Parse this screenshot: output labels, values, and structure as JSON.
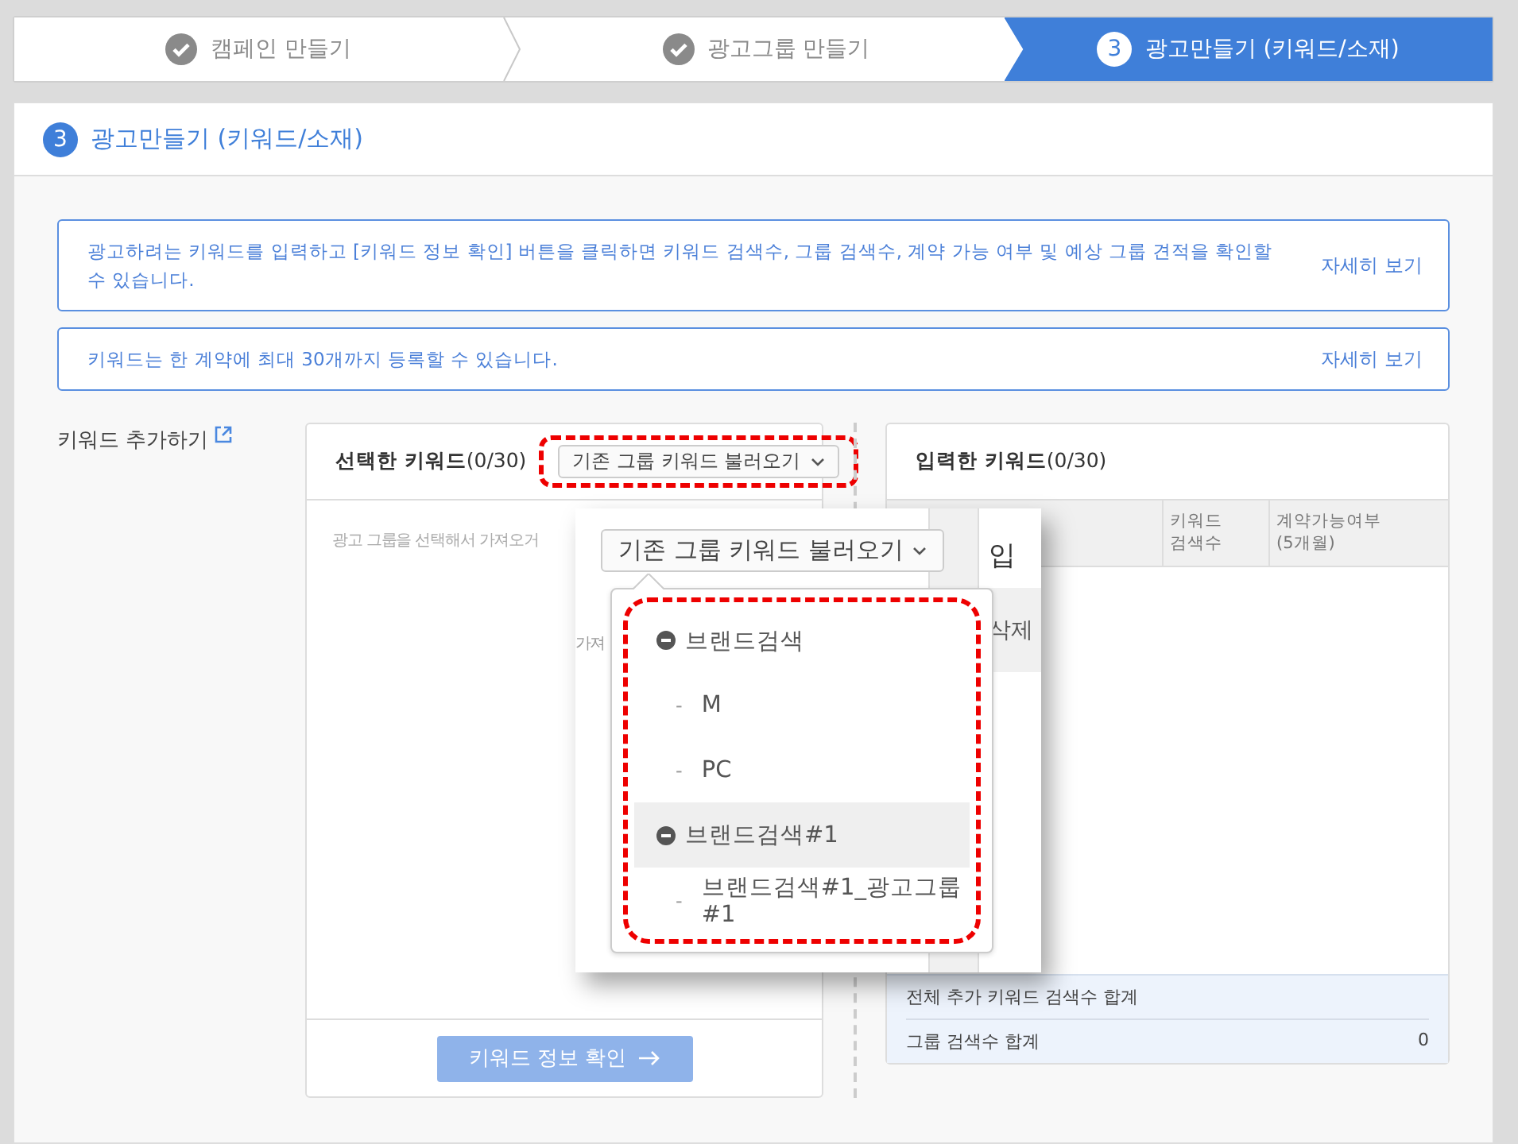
{
  "stepper": [
    {
      "label": "캠페인 만들기",
      "current": false
    },
    {
      "label": "광고그룹 만들기",
      "current": false
    },
    {
      "label": "광고만들기 (키워드/소재)",
      "current": true,
      "number": "3"
    }
  ],
  "section": {
    "number": "3",
    "title": "광고만들기 (키워드/소재)"
  },
  "notices": [
    {
      "text": "광고하려는 키워드를 입력하고 [키워드 정보 확인] 버튼을 클릭하면 키워드 검색수, 그룹 검색수, 계약 가능 여부 및 예상 그룹 견적을 확인할 수 있습니다.",
      "link": "자세히 보기"
    },
    {
      "text": "키워드는 한 계약에 최대 30개까지 등록할 수 있습니다.",
      "link": "자세히 보기"
    }
  ],
  "keyword_add": {
    "label": "키워드 추가하기"
  },
  "selected_panel": {
    "title": "선택한 키워드",
    "count": "(0/30)",
    "load_button": "기존 그룹 키워드 불러오기",
    "highlighted": true,
    "placeholder": "광고 그룹을 선택해서 가져오거",
    "confirm_button": "키워드 정보 확인"
  },
  "entered_panel": {
    "title": "입력한 키워드",
    "count": "(0/30)",
    "columns": [
      {
        "lines": [
          "키워드",
          "검색수"
        ]
      },
      {
        "lines": [
          "계약가능여부",
          "(5개월)"
        ]
      }
    ],
    "summary": [
      {
        "label": "전체 추가 키워드 검색수 합계"
      },
      {
        "label": "그룹 검색수 합계",
        "value": "0"
      }
    ]
  },
  "zoom_inset": {
    "load_button": "기존 그룹 키워드 불러오기",
    "placeholder_part": "가져",
    "column_part": "입",
    "action_part": "삭제",
    "highlighted": true,
    "menu": [
      {
        "label": "브랜드검색",
        "selected": false,
        "children": [
          {
            "marker": "-",
            "label": "M"
          },
          {
            "marker": "-",
            "label": "PC"
          }
        ]
      },
      {
        "label": "브랜드검색#1",
        "selected": true,
        "children": [
          {
            "marker": "-",
            "label": "브랜드검색#1_광고그룹#1"
          }
        ]
      }
    ]
  }
}
